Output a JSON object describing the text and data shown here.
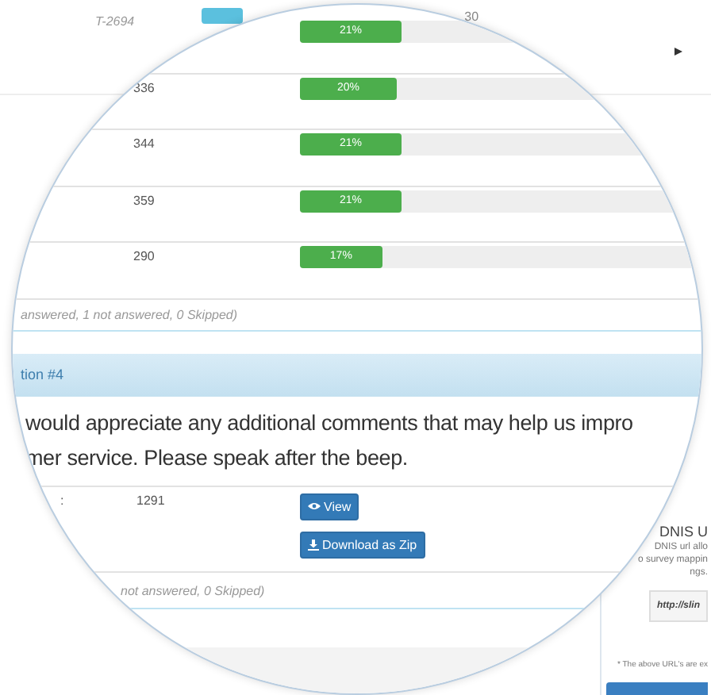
{
  "background": {
    "top_row": {
      "id_text": "T-2694",
      "count": "30"
    },
    "side_panel": {
      "title": "DNIS U",
      "lines": [
        "DNIS url allo",
        "o survey mappin",
        "ngs."
      ],
      "url": "http://slin",
      "note": "* The above URL's are ex"
    }
  },
  "lens": {
    "rows": [
      {
        "reading": "21%",
        "level": 0.21
      },
      {
        "count": "336",
        "reading": "20%",
        "level": 0.2
      },
      {
        "count": "344",
        "reading": "21%",
        "level": 0.21
      },
      {
        "count": "359",
        "reading": "21%",
        "level": 0.21
      },
      {
        "count": "290",
        "reading": "17%",
        "level": 0.17
      }
    ],
    "summary": "answered, 1 not answered, 0 Skipped)",
    "question_title": "tion #4",
    "question_lines": [
      "would appreciate any additional comments that may help us impro",
      "mer service. Please speak after the beep."
    ],
    "recording": {
      "label": ":",
      "count": "1291",
      "buttons": [
        {
          "kind": "view",
          "label": "View"
        },
        {
          "kind": "download",
          "label": "Download as Zip"
        }
      ]
    },
    "summary_2": "not answered, 0 Skipped)"
  }
}
